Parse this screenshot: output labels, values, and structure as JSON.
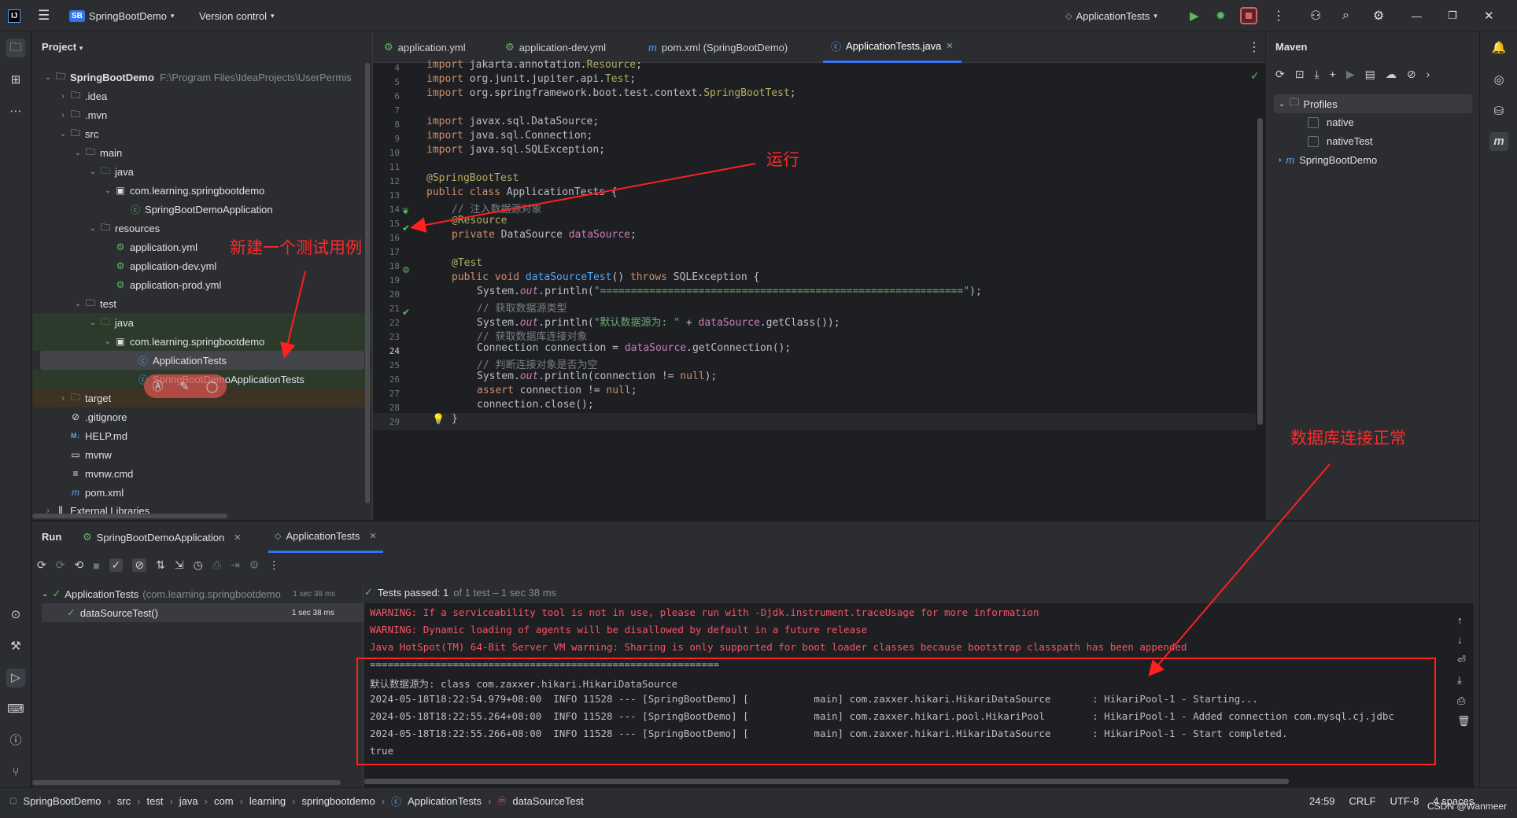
{
  "titlebar": {
    "logo": "IJ",
    "project_badge": "SB",
    "project_name": "SpringBootDemo",
    "vcs": "Version control",
    "run_config": "ApplicationTests",
    "icons": [
      "hamburger-icon",
      "run-icon",
      "debug-icon",
      "stop-icon",
      "more-icon",
      "add-user-icon",
      "search-icon",
      "gear-icon",
      "minimize-icon",
      "restore-icon",
      "close-icon"
    ]
  },
  "project": {
    "header": "Project",
    "root_name": "SpringBootDemo",
    "root_path": "F:\\Program Files\\IdeaProjects\\UserPermis",
    "items": [
      ".idea",
      ".mvn",
      "src",
      "main",
      "java",
      "com.learning.springbootdemo",
      "SpringBootDemoApplication",
      "resources",
      "application.yml",
      "application-dev.yml",
      "application-prod.yml",
      "test",
      "java",
      "com.learning.springbootdemo",
      "ApplicationTests",
      "SpringBootDemoApplicationTests",
      "target",
      ".gitignore",
      "HELP.md",
      "mvnw",
      "mvnw.cmd",
      "pom.xml",
      "External Libraries"
    ]
  },
  "editor": {
    "tabs": [
      "application.yml",
      "application-dev.yml",
      "pom.xml (SpringBootDemo)",
      "ApplicationTests.java"
    ],
    "current_line": "24",
    "line_numbers": [
      "4",
      "5",
      "6",
      "7",
      "8",
      "9",
      "10",
      "11",
      "12",
      "13",
      "14",
      "15",
      "16",
      "17",
      "18",
      "19",
      "20",
      "21",
      "22",
      "23",
      "24",
      "25",
      "26",
      "27",
      "28",
      "29"
    ],
    "lines": {
      "l4a": "import ",
      "l4b": "jakarta.annotation.",
      "l4c": "Resource",
      "l4d": ";",
      "l5a": "import ",
      "l5b": "org.junit.jupiter.api.",
      "l5c": "Test",
      "l5d": ";",
      "l6a": "import ",
      "l6b": "org.springframework.boot.test.context.",
      "l6c": "SpringBootTest",
      "l6d": ";",
      "l8a": "import ",
      "l8b": "javax.sql.DataSource;",
      "l9a": "import ",
      "l9b": "java.sql.Connection;",
      "l10a": "import ",
      "l10b": "java.sql.SQLException;",
      "l12": "@SpringBootTest",
      "l13a": "public class ",
      "l13b": "ApplicationTests {",
      "l14": "// 注入数据源对象",
      "l15": "@Resource",
      "l16a": "private ",
      "l16b": "DataSource ",
      "l16c": "dataSource",
      "l16d": ";",
      "l18": "@Test",
      "l19a": "public void ",
      "l19b": "dataSourceTest",
      "l19c": "() ",
      "l19d": "throws ",
      "l19e": "SQLException {",
      "l20a": "System.",
      "l20b": "out",
      "l20c": ".println(",
      "l20d": "\"===========================================================\"",
      "l20e": ");",
      "l21": "// 获取数据源类型",
      "l22a": "System.",
      "l22b": "out",
      "l22c": ".println(",
      "l22d": "\"默认数据源为: \"",
      "l22e": " + ",
      "l22f": "dataSource",
      "l22g": ".getClass());",
      "l23": "// 获取数据库连接对象",
      "l24a": "Connection connection = ",
      "l24b": "dataSource",
      "l24c": ".getConnection();",
      "l25": "// 判断连接对象是否为空",
      "l26a": "System.",
      "l26b": "out",
      "l26c": ".println(connection != ",
      "l26d": "null",
      "l26e": ");",
      "l27a": "assert ",
      "l27b": "connection != ",
      "l27c": "null",
      "l27d": ";",
      "l28": "connection.close();",
      "l29": "}"
    }
  },
  "maven": {
    "header": "Maven",
    "profiles": "Profiles",
    "items": [
      "native",
      "nativeTest"
    ],
    "project": "SpringBootDemo"
  },
  "run": {
    "label": "Run",
    "tabs": [
      "SpringBootDemoApplication",
      "ApplicationTests"
    ],
    "tree_root": "ApplicationTests",
    "tree_root_pkg": "(com.learning.springbootdemo",
    "tree_root_time": "1 sec 38 ms",
    "tree_child": "dataSourceTest()",
    "tree_child_time": "1 sec 38 ms",
    "result_passed": "Tests passed: 1",
    "result_detail": "of 1 test – 1 sec 38 ms",
    "console": [
      "WARNING: If a serviceability tool is not in use, please run with -Djdk.instrument.traceUsage for more information",
      "WARNING: Dynamic loading of agents will be disallowed by default in a future release",
      "Java HotSpot(TM) 64-Bit Server VM warning: Sharing is only supported for boot loader classes because bootstrap classpath has been appended",
      "===========================================================",
      "默认数据源为: class com.zaxxer.hikari.HikariDataSource",
      "2024-05-18T18:22:54.979+08:00  INFO 11528 --- [SpringBootDemo] [           main] com.zaxxer.hikari.HikariDataSource       : HikariPool-1 - Starting...",
      "2024-05-18T18:22:55.264+08:00  INFO 11528 --- [SpringBootDemo] [           main] com.zaxxer.hikari.pool.HikariPool        : HikariPool-1 - Added connection com.mysql.cj.jdbc",
      "2024-05-18T18:22:55.266+08:00  INFO 11528 --- [SpringBootDemo] [           main] com.zaxxer.hikari.HikariDataSource       : HikariPool-1 - Start completed.",
      "true"
    ]
  },
  "statusbar": {
    "breadcrumbs": [
      "SpringBootDemo",
      "src",
      "test",
      "java",
      "com",
      "learning",
      "springbootdemo",
      "ApplicationTests",
      "dataSourceTest"
    ],
    "position": "24:59",
    "line_sep": "CRLF",
    "encoding": "UTF-8",
    "indent": "4 spaces",
    "watermark": "CSDN @Wanmeer"
  },
  "annotations": {
    "run": "运行",
    "new_test": "新建一个测试用例",
    "db_ok": "数据库连接正常"
  },
  "colors": {
    "accent": "#3574f0",
    "annotation": "#ff2a2a",
    "pass": "#5fb865"
  }
}
